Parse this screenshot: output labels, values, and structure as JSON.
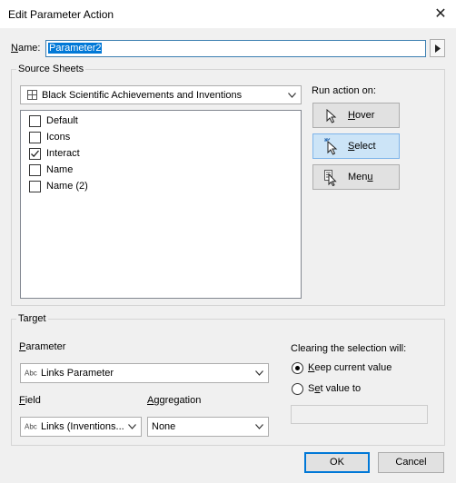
{
  "window": {
    "title": "Edit Parameter Action",
    "close_glyph": "✕"
  },
  "name_field": {
    "label_prefix": "",
    "label_underline": "N",
    "label_rest": "ame:",
    "value": "Parameter2"
  },
  "source_sheets": {
    "title": "Source Sheets",
    "datasource_value": "Black Scientific Achievements and Inventions",
    "sheets": [
      {
        "label": "Default",
        "checked": false
      },
      {
        "label": "Icons",
        "checked": false
      },
      {
        "label": "Interact",
        "checked": true
      },
      {
        "label": "Name",
        "checked": false
      },
      {
        "label": "Name (2)",
        "checked": false
      }
    ],
    "run_action_label": "Run action on:",
    "actions": [
      {
        "u": "H",
        "rest": "over",
        "selected": false,
        "icon": "pointer-icon"
      },
      {
        "u": "S",
        "rest": "elect",
        "selected": true,
        "icon": "select-pointer-icon"
      },
      {
        "pre": "Men",
        "u": "u",
        "selected": false,
        "icon": "menu-pointer-icon"
      }
    ]
  },
  "target": {
    "title": "Target",
    "parameter_label_u": "P",
    "parameter_label_rest": "arameter",
    "parameter_value": "Links Parameter",
    "field_label_u": "F",
    "field_label_rest": "ield",
    "field_value": "Links (Inventions...",
    "aggregation_label_u": "A",
    "aggregation_label_rest": "ggregation",
    "aggregation_value": "None",
    "type_badge": "Abc",
    "clearing_label": "Clearing the selection will:",
    "keep_u": "K",
    "keep_rest": "eep current value",
    "set_pre": "S",
    "set_u": "e",
    "set_rest": "t value to",
    "keep_selected": true
  },
  "buttons": {
    "ok": "OK",
    "cancel": "Cancel"
  },
  "colors": {
    "accent": "#0078d7",
    "selected_button": "#cce4f7"
  }
}
